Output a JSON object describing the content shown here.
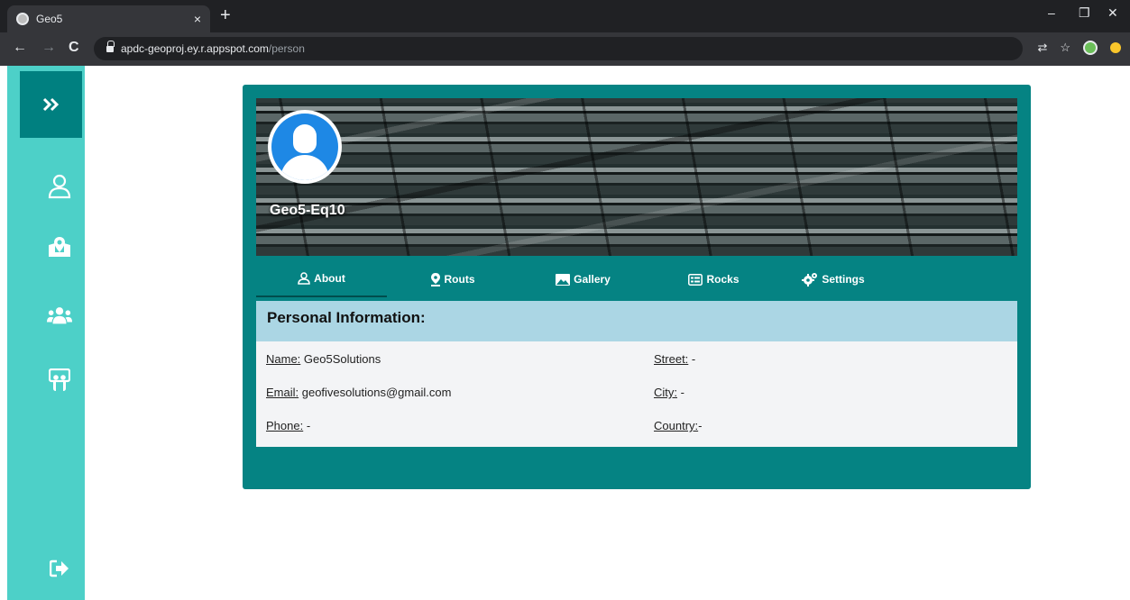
{
  "browser": {
    "tab_title": "Geo5",
    "tab_close": "×",
    "new_tab": "+",
    "url_host": "apdc-geoproj.ey.r.appspot.com",
    "url_path": "/person",
    "win_minimize": "–",
    "win_restore": "❐",
    "win_close": "✕"
  },
  "sidebar": {
    "expand_glyph": "»",
    "items": [
      "profile",
      "map",
      "groups",
      "rocks",
      "logout"
    ]
  },
  "profile": {
    "name": "Geo5-Eq10"
  },
  "tabs": [
    {
      "label": "About",
      "icon": "user-icon",
      "active": true
    },
    {
      "label": "Routs",
      "icon": "map-pin-icon",
      "active": false
    },
    {
      "label": "Gallery",
      "icon": "image-icon",
      "active": false
    },
    {
      "label": "Rocks",
      "icon": "list-icon",
      "active": false
    },
    {
      "label": "Settings",
      "icon": "gear-icon",
      "active": false
    }
  ],
  "info": {
    "title": "Personal Information:",
    "fields": {
      "name_label": "Name:",
      "name_value": " Geo5Solutions",
      "email_label": "Email:",
      "email_value": " geofivesolutions@gmail.com",
      "phone_label": "Phone:",
      "phone_value": " -",
      "street_label": "Street:",
      "street_value": " -",
      "city_label": "City:",
      "city_value": " -",
      "country_label": "Country:",
      "country_value": "-"
    }
  },
  "colors": {
    "teal": "#058383",
    "sidebar": "#4dd0c8",
    "info_header": "#abd6e4"
  }
}
